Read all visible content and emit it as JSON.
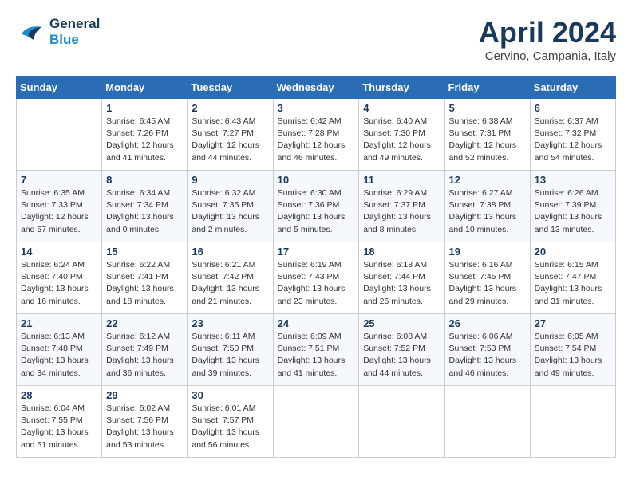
{
  "header": {
    "logo_line1": "General",
    "logo_line2": "Blue",
    "month_title": "April 2024",
    "location": "Cervino, Campania, Italy"
  },
  "columns": [
    "Sunday",
    "Monday",
    "Tuesday",
    "Wednesday",
    "Thursday",
    "Friday",
    "Saturday"
  ],
  "weeks": [
    [
      {
        "day": "",
        "sunrise": "",
        "sunset": "",
        "daylight": ""
      },
      {
        "day": "1",
        "sunrise": "Sunrise: 6:45 AM",
        "sunset": "Sunset: 7:26 PM",
        "daylight": "Daylight: 12 hours and 41 minutes."
      },
      {
        "day": "2",
        "sunrise": "Sunrise: 6:43 AM",
        "sunset": "Sunset: 7:27 PM",
        "daylight": "Daylight: 12 hours and 44 minutes."
      },
      {
        "day": "3",
        "sunrise": "Sunrise: 6:42 AM",
        "sunset": "Sunset: 7:28 PM",
        "daylight": "Daylight: 12 hours and 46 minutes."
      },
      {
        "day": "4",
        "sunrise": "Sunrise: 6:40 AM",
        "sunset": "Sunset: 7:30 PM",
        "daylight": "Daylight: 12 hours and 49 minutes."
      },
      {
        "day": "5",
        "sunrise": "Sunrise: 6:38 AM",
        "sunset": "Sunset: 7:31 PM",
        "daylight": "Daylight: 12 hours and 52 minutes."
      },
      {
        "day": "6",
        "sunrise": "Sunrise: 6:37 AM",
        "sunset": "Sunset: 7:32 PM",
        "daylight": "Daylight: 12 hours and 54 minutes."
      }
    ],
    [
      {
        "day": "7",
        "sunrise": "Sunrise: 6:35 AM",
        "sunset": "Sunset: 7:33 PM",
        "daylight": "Daylight: 12 hours and 57 minutes."
      },
      {
        "day": "8",
        "sunrise": "Sunrise: 6:34 AM",
        "sunset": "Sunset: 7:34 PM",
        "daylight": "Daylight: 13 hours and 0 minutes."
      },
      {
        "day": "9",
        "sunrise": "Sunrise: 6:32 AM",
        "sunset": "Sunset: 7:35 PM",
        "daylight": "Daylight: 13 hours and 2 minutes."
      },
      {
        "day": "10",
        "sunrise": "Sunrise: 6:30 AM",
        "sunset": "Sunset: 7:36 PM",
        "daylight": "Daylight: 13 hours and 5 minutes."
      },
      {
        "day": "11",
        "sunrise": "Sunrise: 6:29 AM",
        "sunset": "Sunset: 7:37 PM",
        "daylight": "Daylight: 13 hours and 8 minutes."
      },
      {
        "day": "12",
        "sunrise": "Sunrise: 6:27 AM",
        "sunset": "Sunset: 7:38 PM",
        "daylight": "Daylight: 13 hours and 10 minutes."
      },
      {
        "day": "13",
        "sunrise": "Sunrise: 6:26 AM",
        "sunset": "Sunset: 7:39 PM",
        "daylight": "Daylight: 13 hours and 13 minutes."
      }
    ],
    [
      {
        "day": "14",
        "sunrise": "Sunrise: 6:24 AM",
        "sunset": "Sunset: 7:40 PM",
        "daylight": "Daylight: 13 hours and 16 minutes."
      },
      {
        "day": "15",
        "sunrise": "Sunrise: 6:22 AM",
        "sunset": "Sunset: 7:41 PM",
        "daylight": "Daylight: 13 hours and 18 minutes."
      },
      {
        "day": "16",
        "sunrise": "Sunrise: 6:21 AM",
        "sunset": "Sunset: 7:42 PM",
        "daylight": "Daylight: 13 hours and 21 minutes."
      },
      {
        "day": "17",
        "sunrise": "Sunrise: 6:19 AM",
        "sunset": "Sunset: 7:43 PM",
        "daylight": "Daylight: 13 hours and 23 minutes."
      },
      {
        "day": "18",
        "sunrise": "Sunrise: 6:18 AM",
        "sunset": "Sunset: 7:44 PM",
        "daylight": "Daylight: 13 hours and 26 minutes."
      },
      {
        "day": "19",
        "sunrise": "Sunrise: 6:16 AM",
        "sunset": "Sunset: 7:45 PM",
        "daylight": "Daylight: 13 hours and 29 minutes."
      },
      {
        "day": "20",
        "sunrise": "Sunrise: 6:15 AM",
        "sunset": "Sunset: 7:47 PM",
        "daylight": "Daylight: 13 hours and 31 minutes."
      }
    ],
    [
      {
        "day": "21",
        "sunrise": "Sunrise: 6:13 AM",
        "sunset": "Sunset: 7:48 PM",
        "daylight": "Daylight: 13 hours and 34 minutes."
      },
      {
        "day": "22",
        "sunrise": "Sunrise: 6:12 AM",
        "sunset": "Sunset: 7:49 PM",
        "daylight": "Daylight: 13 hours and 36 minutes."
      },
      {
        "day": "23",
        "sunrise": "Sunrise: 6:11 AM",
        "sunset": "Sunset: 7:50 PM",
        "daylight": "Daylight: 13 hours and 39 minutes."
      },
      {
        "day": "24",
        "sunrise": "Sunrise: 6:09 AM",
        "sunset": "Sunset: 7:51 PM",
        "daylight": "Daylight: 13 hours and 41 minutes."
      },
      {
        "day": "25",
        "sunrise": "Sunrise: 6:08 AM",
        "sunset": "Sunset: 7:52 PM",
        "daylight": "Daylight: 13 hours and 44 minutes."
      },
      {
        "day": "26",
        "sunrise": "Sunrise: 6:06 AM",
        "sunset": "Sunset: 7:53 PM",
        "daylight": "Daylight: 13 hours and 46 minutes."
      },
      {
        "day": "27",
        "sunrise": "Sunrise: 6:05 AM",
        "sunset": "Sunset: 7:54 PM",
        "daylight": "Daylight: 13 hours and 49 minutes."
      }
    ],
    [
      {
        "day": "28",
        "sunrise": "Sunrise: 6:04 AM",
        "sunset": "Sunset: 7:55 PM",
        "daylight": "Daylight: 13 hours and 51 minutes."
      },
      {
        "day": "29",
        "sunrise": "Sunrise: 6:02 AM",
        "sunset": "Sunset: 7:56 PM",
        "daylight": "Daylight: 13 hours and 53 minutes."
      },
      {
        "day": "30",
        "sunrise": "Sunrise: 6:01 AM",
        "sunset": "Sunset: 7:57 PM",
        "daylight": "Daylight: 13 hours and 56 minutes."
      },
      {
        "day": "",
        "sunrise": "",
        "sunset": "",
        "daylight": ""
      },
      {
        "day": "",
        "sunrise": "",
        "sunset": "",
        "daylight": ""
      },
      {
        "day": "",
        "sunrise": "",
        "sunset": "",
        "daylight": ""
      },
      {
        "day": "",
        "sunrise": "",
        "sunset": "",
        "daylight": ""
      }
    ]
  ]
}
